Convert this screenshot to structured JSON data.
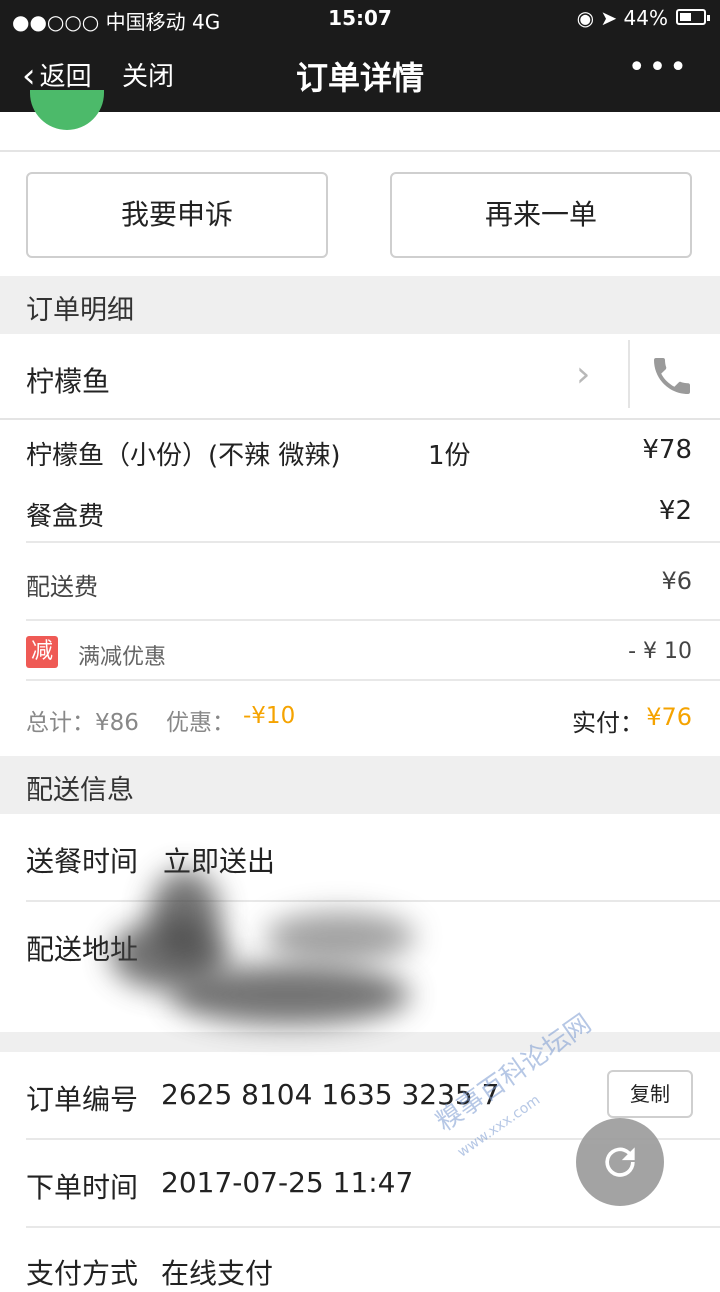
{
  "status_bar": {
    "signal": "●●○○○ 中国移动  4G",
    "time": "15:07",
    "indicators": "◉  ➤  44%"
  },
  "nav": {
    "back_label": "返回",
    "close_label": "关闭",
    "title": "订单详情",
    "more_icon": "•••"
  },
  "actions": {
    "complain": "我要申诉",
    "reorder": "再来一单"
  },
  "order_detail": {
    "section_title": "订单明细",
    "shop_name": "柠檬鱼",
    "item_name": "柠檬鱼（小份）(不辣 微辣)",
    "item_qty": "1份",
    "item_price": "¥78",
    "box_fee_label": "餐盒费",
    "box_fee": "¥2",
    "delivery_fee_label": "配送费",
    "delivery_fee": "¥6",
    "discount_badge": "减",
    "discount_label": "满减优惠",
    "discount_value": "- ¥ 10",
    "total_label": "总计：¥86",
    "offer_label": "优惠：",
    "offer_value": "-¥10",
    "paid_label": "实付：",
    "paid_value": "¥76"
  },
  "delivery_info": {
    "section_title": "配送信息",
    "time_label": "送餐时间",
    "time_value": "立即送出",
    "address_label": "配送地址"
  },
  "order_info": {
    "number_label": "订单编号",
    "number_value": "2625 8104 1635 3235 7",
    "copy_label": "复制",
    "time_label": "下单时间",
    "time_value": "2017-07-25 11:47",
    "pay_label": "支付方式",
    "pay_value": "在线支付"
  },
  "watermark": {
    "text": "糗事百科论坛网",
    "url": "www.xxx.com"
  },
  "colors": {
    "accent_orange": "#f5a300",
    "discount_red": "#ef5a55",
    "bar_dark": "#1b1b1b"
  }
}
